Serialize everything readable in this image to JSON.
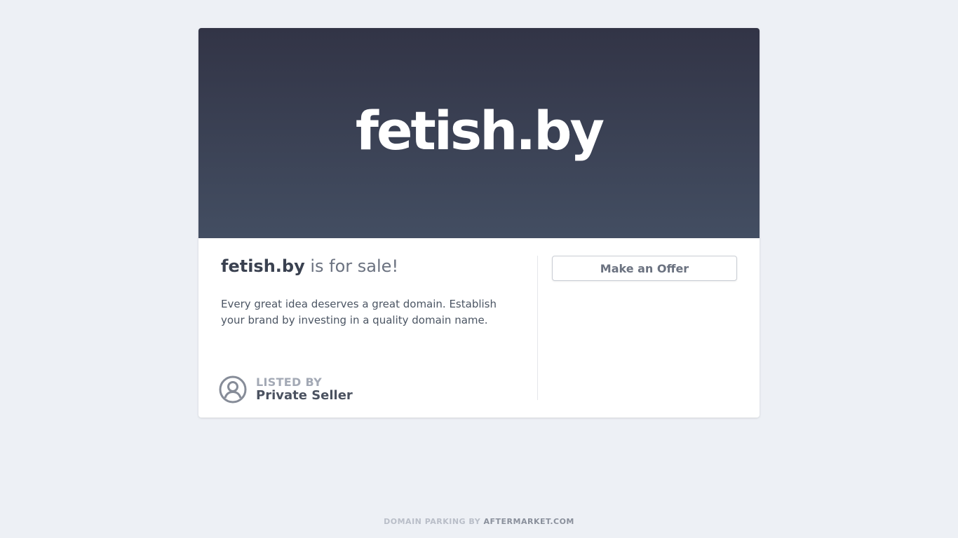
{
  "hero": {
    "domain": "fetish.by"
  },
  "headline": {
    "domain": "fetish.by",
    "suffix": " is for sale!"
  },
  "description": "Every great idea deserves a great domain. Establish your brand by investing in a quality domain name.",
  "listed": {
    "label": "LISTED BY",
    "seller": "Private Seller",
    "icon": "user-circle-icon"
  },
  "offer": {
    "label": "Make an Offer"
  },
  "footer": {
    "prefix": "DOMAIN PARKING BY ",
    "brand": "AFTERMARKET.COM"
  },
  "colors": {
    "page_background": "#edf0f5",
    "hero_top": "#323446",
    "hero_bottom": "#434e62",
    "heading_text": "#3a4150",
    "muted_text": "#6b7280"
  }
}
